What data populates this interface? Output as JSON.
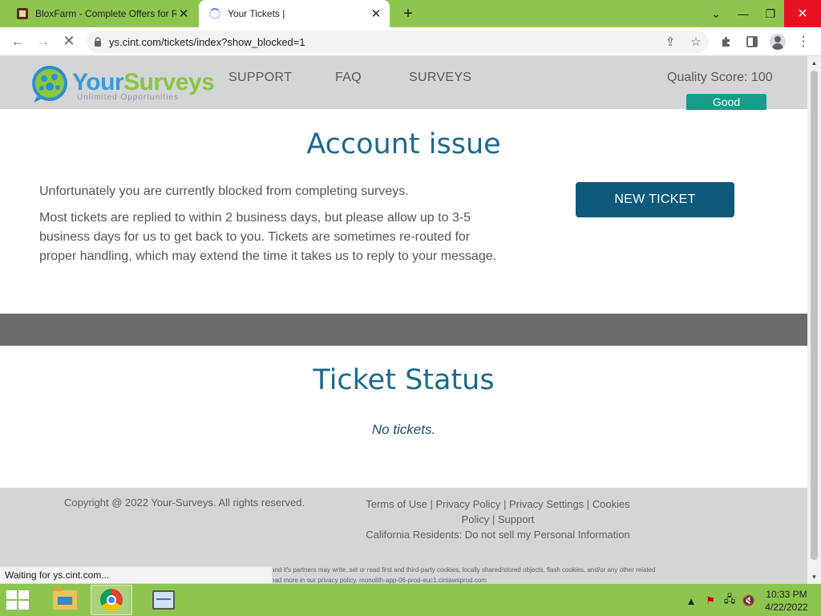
{
  "browser": {
    "tabs": [
      {
        "title": "BloxFarm - Complete Offers for R"
      },
      {
        "title": "Your Tickets |"
      }
    ],
    "url": "ys.cint.com/tickets/index?show_blocked=1",
    "status": "Waiting for ys.cint.com..."
  },
  "header": {
    "logo_your": "Your",
    "logo_surveys": "Surveys",
    "logo_tagline": "Unlimited Opportunities",
    "nav": [
      "SUPPORT",
      "FAQ",
      "SURVEYS"
    ],
    "quality_score": "Quality Score: 100",
    "quality_badge": "Good"
  },
  "account": {
    "title": "Account issue",
    "blocked_text": "Unfortunately you are currently blocked from completing surveys.",
    "reply_text": "Most tickets are replied to within 2 business days, but please allow up to 3-5 business days for us to get back to you. Tickets are sometimes re-routed for proper handling, which may extend the time it takes us to reply to your message.",
    "new_ticket_label": "NEW TICKET"
  },
  "tickets": {
    "title": "Ticket Status",
    "empty_text": "No tickets."
  },
  "footer": {
    "copyright": "Copyright @ 2022 Your-Surveys. All rights reserved.",
    "links": {
      "terms": "Terms of Use",
      "privacy": "Privacy Policy",
      "privacy_settings": "Privacy Settings",
      "cookies": "Cookies Policy",
      "support": "Support",
      "ca_residents": "California Residents: Do not sell my Personal Information"
    },
    "fine_print_1": "and it's partners may write, set or read first and third-party cookies, locally shared/stored objects, flash cookies, and/or any other related",
    "fine_print_2": "ead more in our privacy policy.  monolith-app-06-prod-euc1.cintawsprod.com"
  },
  "taskbar": {
    "time": "10:33 PM",
    "date": "4/22/2022"
  },
  "colors": {
    "accent_green": "#8ec54f",
    "header_gray": "#d3d5d7",
    "title_blue": "#1b6a8a",
    "button_blue": "#0f5a7a",
    "badge_teal": "#1a9a8a",
    "band_gray": "#6b6b6b"
  }
}
